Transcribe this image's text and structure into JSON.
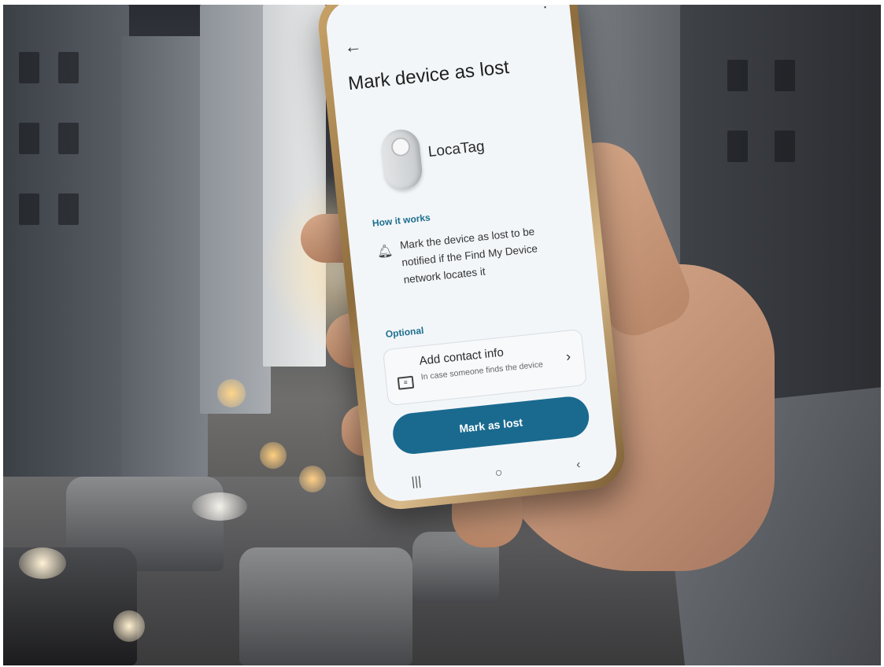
{
  "phone_screen": {
    "title": "Mark device as lost",
    "device_name": "LocaTag",
    "how_it_works_label": "How it works",
    "how_it_works_text": "Mark the device as lost to be notified if the Find My Device network locates it",
    "optional_label": "Optional",
    "contact_title": "Add contact info",
    "contact_subtitle": "In case someone finds the device",
    "primary_button": "Mark as lost",
    "accent_color": "#1a6a8f",
    "icons": [
      "back-arrow-icon",
      "more-vert-icon",
      "bell-icon",
      "contact-card-icon",
      "chevron-right-icon",
      "recents-icon",
      "home-icon",
      "back-nav-icon"
    ],
    "nav": {
      "recents": "|||",
      "home": "○",
      "back": "‹"
    }
  }
}
